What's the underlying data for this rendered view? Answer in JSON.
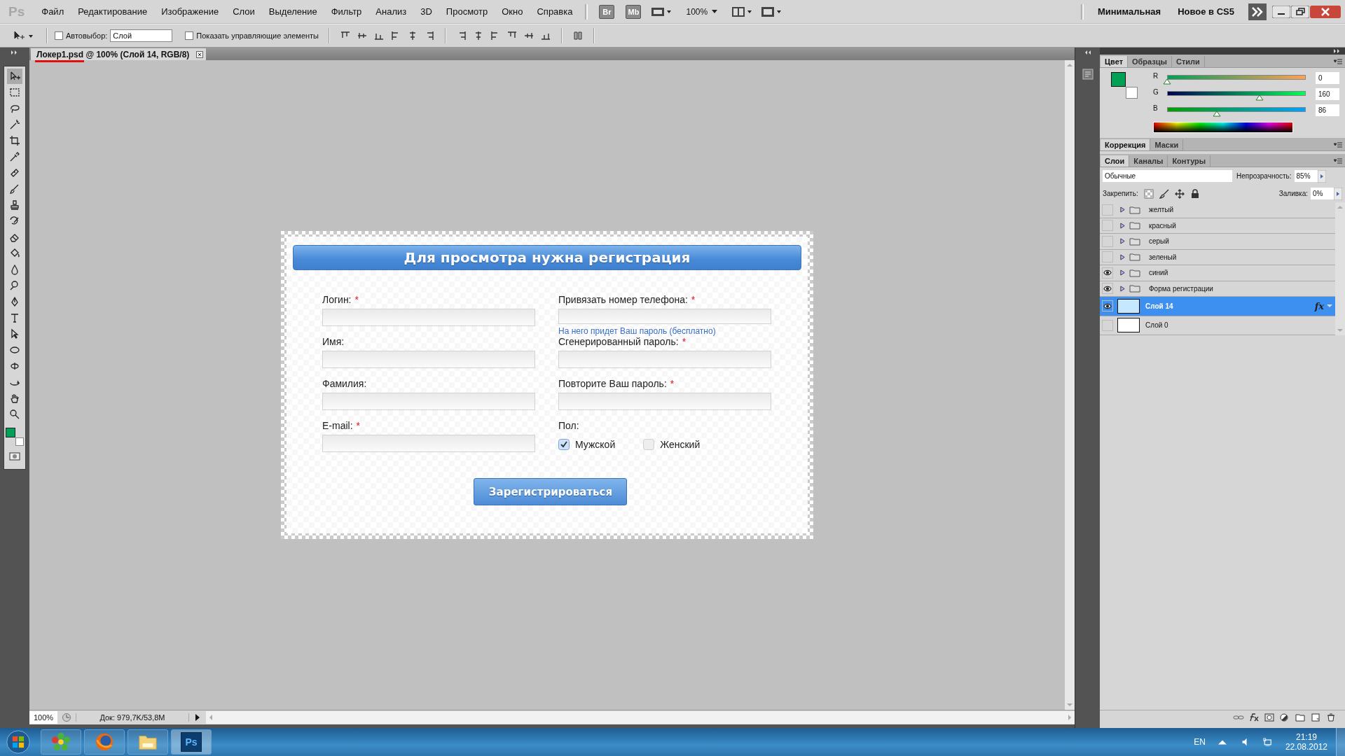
{
  "app_logo": "Ps",
  "menu": [
    "Файл",
    "Редактирование",
    "Изображение",
    "Слои",
    "Выделение",
    "Фильтр",
    "Анализ",
    "3D",
    "Просмотр",
    "Окно",
    "Справка"
  ],
  "app_bar": {
    "bridge": "Br",
    "mini_bridge": "Mb",
    "zoom": "100%"
  },
  "workspaces": [
    "Минимальная",
    "Новое в CS5"
  ],
  "options_bar": {
    "auto_select": {
      "label": "Автовыбор:",
      "checked": false,
      "value": "Слой"
    },
    "show_controls": {
      "label": "Показать управляющие элементы",
      "checked": false
    }
  },
  "document_tab": {
    "title": "Локер1.psd @ 100% (Слой 14, RGB/8)"
  },
  "form": {
    "title": "Для просмотра нужна регистрация",
    "required_mark": "*",
    "left_fields": [
      {
        "label": "Логин:",
        "required": true
      },
      {
        "label": "Имя:",
        "required": false
      },
      {
        "label": "Фамилия:",
        "required": false
      },
      {
        "label": "E-mail:",
        "required": true
      }
    ],
    "right_fields": [
      {
        "label": "Привязать номер телефона:",
        "required": true,
        "hint": "На него придет Ваш пароль (бесплатно)"
      },
      {
        "label": "Сгенерированный пароль:",
        "required": true
      },
      {
        "label": "Повторите Ваш пароль:",
        "required": true
      }
    ],
    "gender": {
      "label": "Пол:",
      "options": [
        {
          "label": "Мужской",
          "checked": true
        },
        {
          "label": "Женский",
          "checked": false
        }
      ]
    },
    "submit": "Зарегистрироваться"
  },
  "color_panel": {
    "tabs": [
      {
        "label": "Цвет",
        "selected": true
      },
      {
        "label": "Образцы",
        "selected": false
      },
      {
        "label": "Стили",
        "selected": false
      }
    ],
    "channels": [
      {
        "name": "R",
        "level": 0,
        "value": "0"
      },
      {
        "name": "G",
        "level": 0.627,
        "value": "160"
      },
      {
        "name": "B",
        "level": 0.337,
        "value": "86"
      }
    ]
  },
  "adjustments_panel": {
    "tabs": [
      {
        "label": "Коррекция",
        "selected": true
      },
      {
        "label": "Маски",
        "selected": false
      }
    ]
  },
  "layers_panel": {
    "tabs": [
      {
        "label": "Слои",
        "selected": true
      },
      {
        "label": "Каналы",
        "selected": false
      },
      {
        "label": "Контуры",
        "selected": false
      }
    ],
    "blend_mode": "Обычные",
    "opacity_label": "Непрозрачность:",
    "opacity": "85%",
    "lock_label": "Закрепить:",
    "fill_label": "Заливка:",
    "fill": "0%",
    "layers": [
      {
        "name": "желтый",
        "kind": "group",
        "visible": false,
        "selected": false
      },
      {
        "name": "красный",
        "kind": "group",
        "visible": false,
        "selected": false
      },
      {
        "name": "серый",
        "kind": "group",
        "visible": false,
        "selected": false
      },
      {
        "name": "зеленый",
        "kind": "group",
        "visible": false,
        "selected": false
      },
      {
        "name": "синий",
        "kind": "group",
        "visible": true,
        "selected": false
      },
      {
        "name": "Форма регистрации",
        "kind": "group",
        "visible": true,
        "selected": false
      },
      {
        "name": "Слой 14",
        "kind": "layer",
        "visible": true,
        "selected": true,
        "effects": "fx",
        "color": "#c6e8ff"
      },
      {
        "name": "Слой 0",
        "kind": "layer",
        "visible": false,
        "selected": false,
        "color": "#ffffff"
      }
    ]
  },
  "status_bar": {
    "zoom": "100%",
    "doc_info": "Док: 979,7K/53,8M"
  },
  "taskbar": {
    "apps": [
      {
        "kind": "flower",
        "selected": false
      },
      {
        "kind": "browser",
        "selected": false
      },
      {
        "kind": "folder",
        "selected": false
      },
      {
        "kind": "photoshop",
        "label": "Ps",
        "selected": true
      }
    ],
    "language": "EN",
    "time": "21:19",
    "date": "22.08.2012"
  }
}
